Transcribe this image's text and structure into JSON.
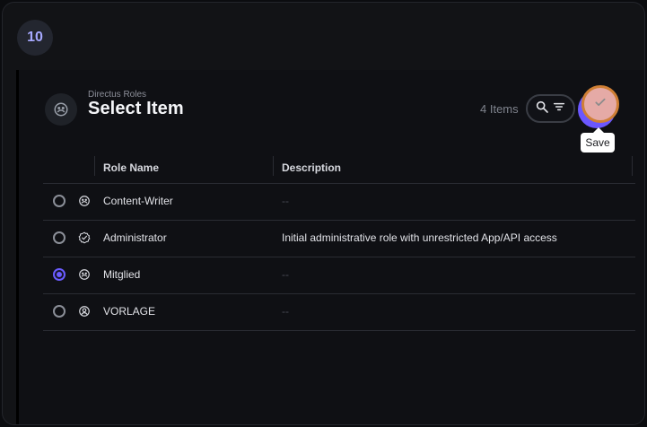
{
  "step_badge": "10",
  "header": {
    "collection": "Directus Roles",
    "title": "Select Item",
    "count": "4 Items",
    "save_tooltip": "Save",
    "icons": {
      "header": "role-avatar-icon",
      "search": "search-icon",
      "filter": "filter-icon",
      "save": "check-icon"
    }
  },
  "table": {
    "columns": [
      "Role Name",
      "Description"
    ],
    "rows": [
      {
        "name": "Content-Writer",
        "description": "--",
        "selected": false,
        "icon": "user-group-icon"
      },
      {
        "name": "Administrator",
        "description": "Initial administrative role with unrestricted App/API access",
        "selected": false,
        "icon": "verified-icon"
      },
      {
        "name": "Mitglied",
        "description": "--",
        "selected": true,
        "icon": "user-group-icon"
      },
      {
        "name": "VORLAGE",
        "description": "--",
        "selected": false,
        "icon": "account-circle-icon"
      }
    ]
  },
  "colors": {
    "accent": "#6a5cff",
    "save_button": "#e5aaa6",
    "save_outline": "#cf7f35"
  }
}
